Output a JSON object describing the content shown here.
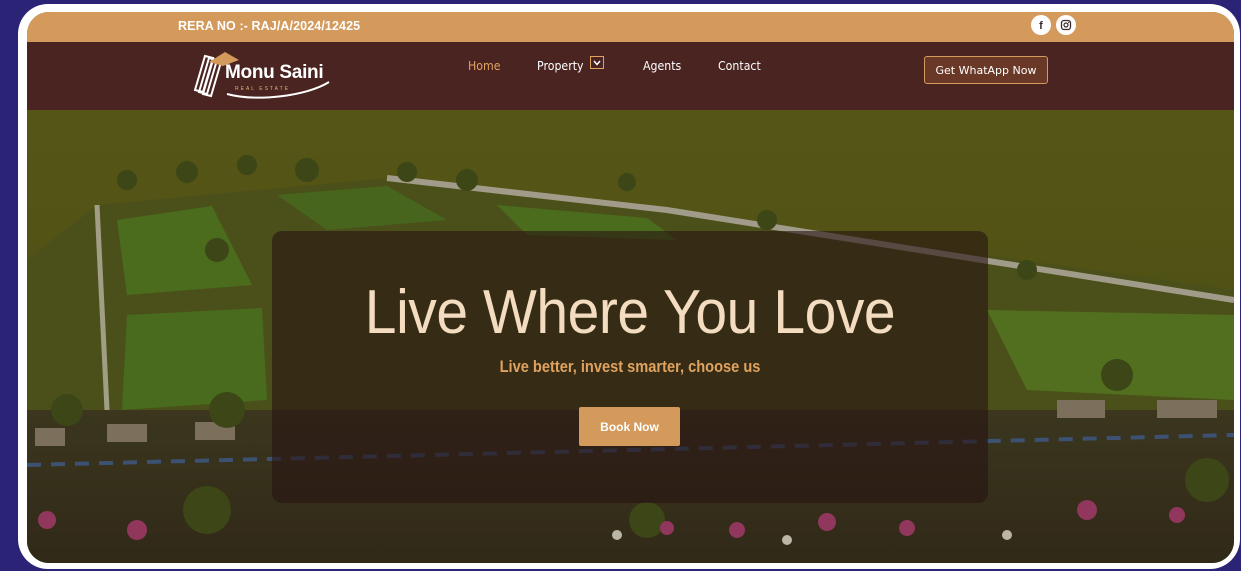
{
  "topbar": {
    "rera": "RERA NO :- RAJ/A/2024/12425",
    "social": [
      {
        "icon": "facebook-icon",
        "glyph": "f"
      },
      {
        "icon": "instagram-icon"
      }
    ]
  },
  "nav": {
    "logo_text": "Monu Saini",
    "logo_sub": "REAL ESTATE",
    "items": [
      {
        "label": "Home",
        "active": true
      },
      {
        "label": "Property",
        "has_dropdown": true
      },
      {
        "label": "Agents"
      },
      {
        "label": "Contact"
      }
    ],
    "cta_label": "Get WhatApp Now"
  },
  "hero": {
    "headline": "Live Where You Love",
    "subline": "Live better, invest smarter, choose us",
    "button_label": "Book Now"
  },
  "colors": {
    "accent": "#d49a5c",
    "nav_bg": "#4a2421",
    "page_bg": "#2a2376",
    "headline": "#f3dcc0"
  }
}
